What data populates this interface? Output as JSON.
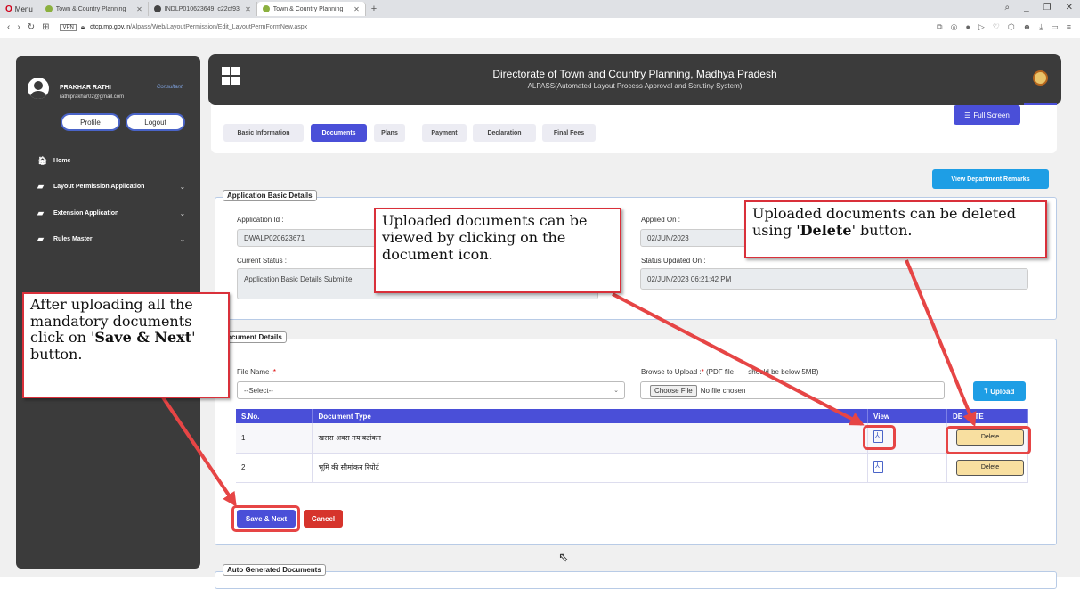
{
  "browser": {
    "menu_label": "Menu",
    "tabs": [
      {
        "title": "Town & Country Planning"
      },
      {
        "title": "INDLP010623649_c22cf93"
      },
      {
        "title": "Town & Country Planning"
      }
    ],
    "url_domain": "dtcp.mp.gov.in",
    "url_path": "/Alpass/Web/LayoutPermission/Edit_LayoutPermFormNew.aspx",
    "vpn_label": "VPN"
  },
  "sidebar": {
    "user_name": "PRAKHAR RATHI",
    "user_role": "Consultant",
    "user_email": "rathiprakhar02@gmail.com",
    "profile_label": "Profile",
    "logout_label": "Logout",
    "items": [
      {
        "label": "Home"
      },
      {
        "label": "Layout Permission Application"
      },
      {
        "label": "Extension Application"
      },
      {
        "label": "Rules Master"
      }
    ]
  },
  "header": {
    "title": "Directorate of Town and Country Planning, Madhya Pradesh",
    "subtitle": "ALPASS(Automated Layout Process Approval and Scrutiny System)"
  },
  "steps": {
    "tabs": [
      "Basic Information",
      "Documents",
      "Plans",
      "Payment",
      "Declaration",
      "Final Fees"
    ],
    "active": "Documents",
    "fullscreen_label": "Full Screen"
  },
  "view_remarks_label": "View Department Remarks",
  "basic_details": {
    "legend": "Application Basic Details",
    "app_id_label": "Application Id :",
    "app_id_value": "DWALP020623671",
    "applied_on_label": "Applied On :",
    "applied_on_value": "02/JUN/2023",
    "status_label": "Current Status :",
    "status_value": "Application Basic Details Submitte",
    "status_updated_label": "Status Updated On :",
    "status_updated_value": "02/JUN/2023 06:21:42 PM"
  },
  "document_details": {
    "legend": "ocument Details",
    "file_name_label": "File Name :",
    "select_value": "--Select--",
    "browse_label": "Browse to Upload :",
    "browse_hint": " (PDF file",
    "browse_hint2": "should be below 5MB)",
    "choose_file_label": "Choose File",
    "no_file_text": "No file chosen",
    "upload_label": "Upload",
    "columns": [
      "S.No.",
      "Document Type",
      "View",
      "DE",
      "ETE"
    ],
    "rows": [
      {
        "sno": "1",
        "type": "खसरा अक्स मय बटांकन",
        "delete": "Delete"
      },
      {
        "sno": "2",
        "type": "भूमि की सीमांकन रिपोर्ट",
        "delete": "Delete"
      }
    ],
    "save_label": "Save & Next",
    "cancel_label": "Cancel"
  },
  "auto_docs_legend": "Auto Generated Documents",
  "callouts": {
    "view": "Uploaded documents can be viewed by clicking on the document icon.",
    "delete_pre": "Uploaded documents can be deleted using '",
    "delete_bold": "Delete",
    "delete_post": "' button.",
    "save_pre": "After uploading all the mandatory documents click on '",
    "save_bold": "Save & Next",
    "save_post": "' button."
  },
  "colors": {
    "accent": "#4a4fd8",
    "info": "#1e9ee5",
    "danger": "#d6342c",
    "annotation": "#d9303a"
  }
}
